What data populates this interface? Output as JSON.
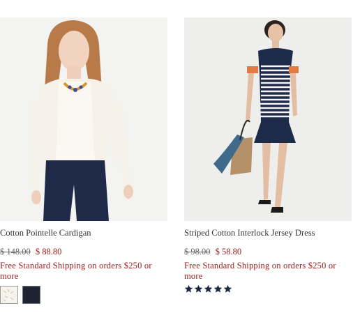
{
  "products": [
    {
      "name": "Cotton Pointelle Cardigan",
      "price_original": "$ 148.00",
      "price_sale": "$ 88.80",
      "shipping_text": "Free Standard Shipping on orders $250 or more",
      "swatches": [
        "ivory",
        "navy"
      ]
    },
    {
      "name": "Striped Cotton Interlock Jersey Dress",
      "price_original": "$ 98.00",
      "price_sale": "$ 58.80",
      "shipping_text": "Free Standard Shipping on orders $250 or more",
      "rating_stars": 5
    }
  ],
  "colors": {
    "sale_price": "#9b1b1b",
    "star": "#1d2a44",
    "swatch_ivory": "#f7f4ee",
    "swatch_navy": "#1d2333"
  }
}
